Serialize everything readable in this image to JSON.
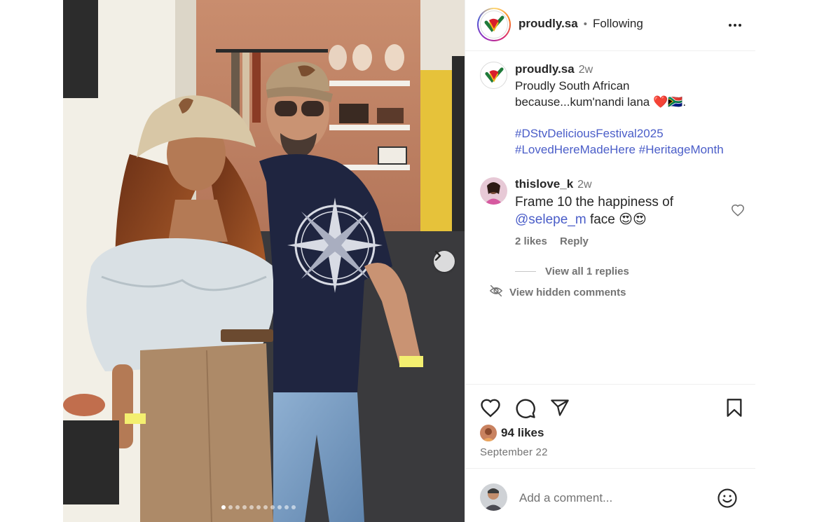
{
  "post": {
    "username": "proudly.sa",
    "follow_status": "Following",
    "separator": "•",
    "more_label": "More options"
  },
  "photo": {
    "carousel_dots": 11,
    "active_dot": 0
  },
  "caption": {
    "username": "proudly.sa",
    "time": "2w",
    "text_line1": "Proudly South African",
    "text_line2": "because...kum'nandi lana ❤️🇿🇦.",
    "hashtags_line1": "#DStvDeliciousFestival2025",
    "hashtags_line2a": "#LovedHereMadeHere",
    "hashtags_line2b": "#HeritageMonth"
  },
  "comment": {
    "username": "thislove_k",
    "time": "2w",
    "text_part1": "Frame 10 the happiness of",
    "mention": "@selepe_m",
    "text_part2": "face 😍😍",
    "likes": "2 likes",
    "reply_label": "Reply"
  },
  "threads": {
    "view_replies": "View all 1 replies",
    "view_hidden": "View hidden comments"
  },
  "stats": {
    "likes": "94 likes",
    "date": "September 22"
  },
  "composer": {
    "placeholder": "Add a comment..."
  },
  "colors": {
    "link": "#4a5dc8",
    "secondary_text": "#737373",
    "primary_text": "#262626"
  }
}
